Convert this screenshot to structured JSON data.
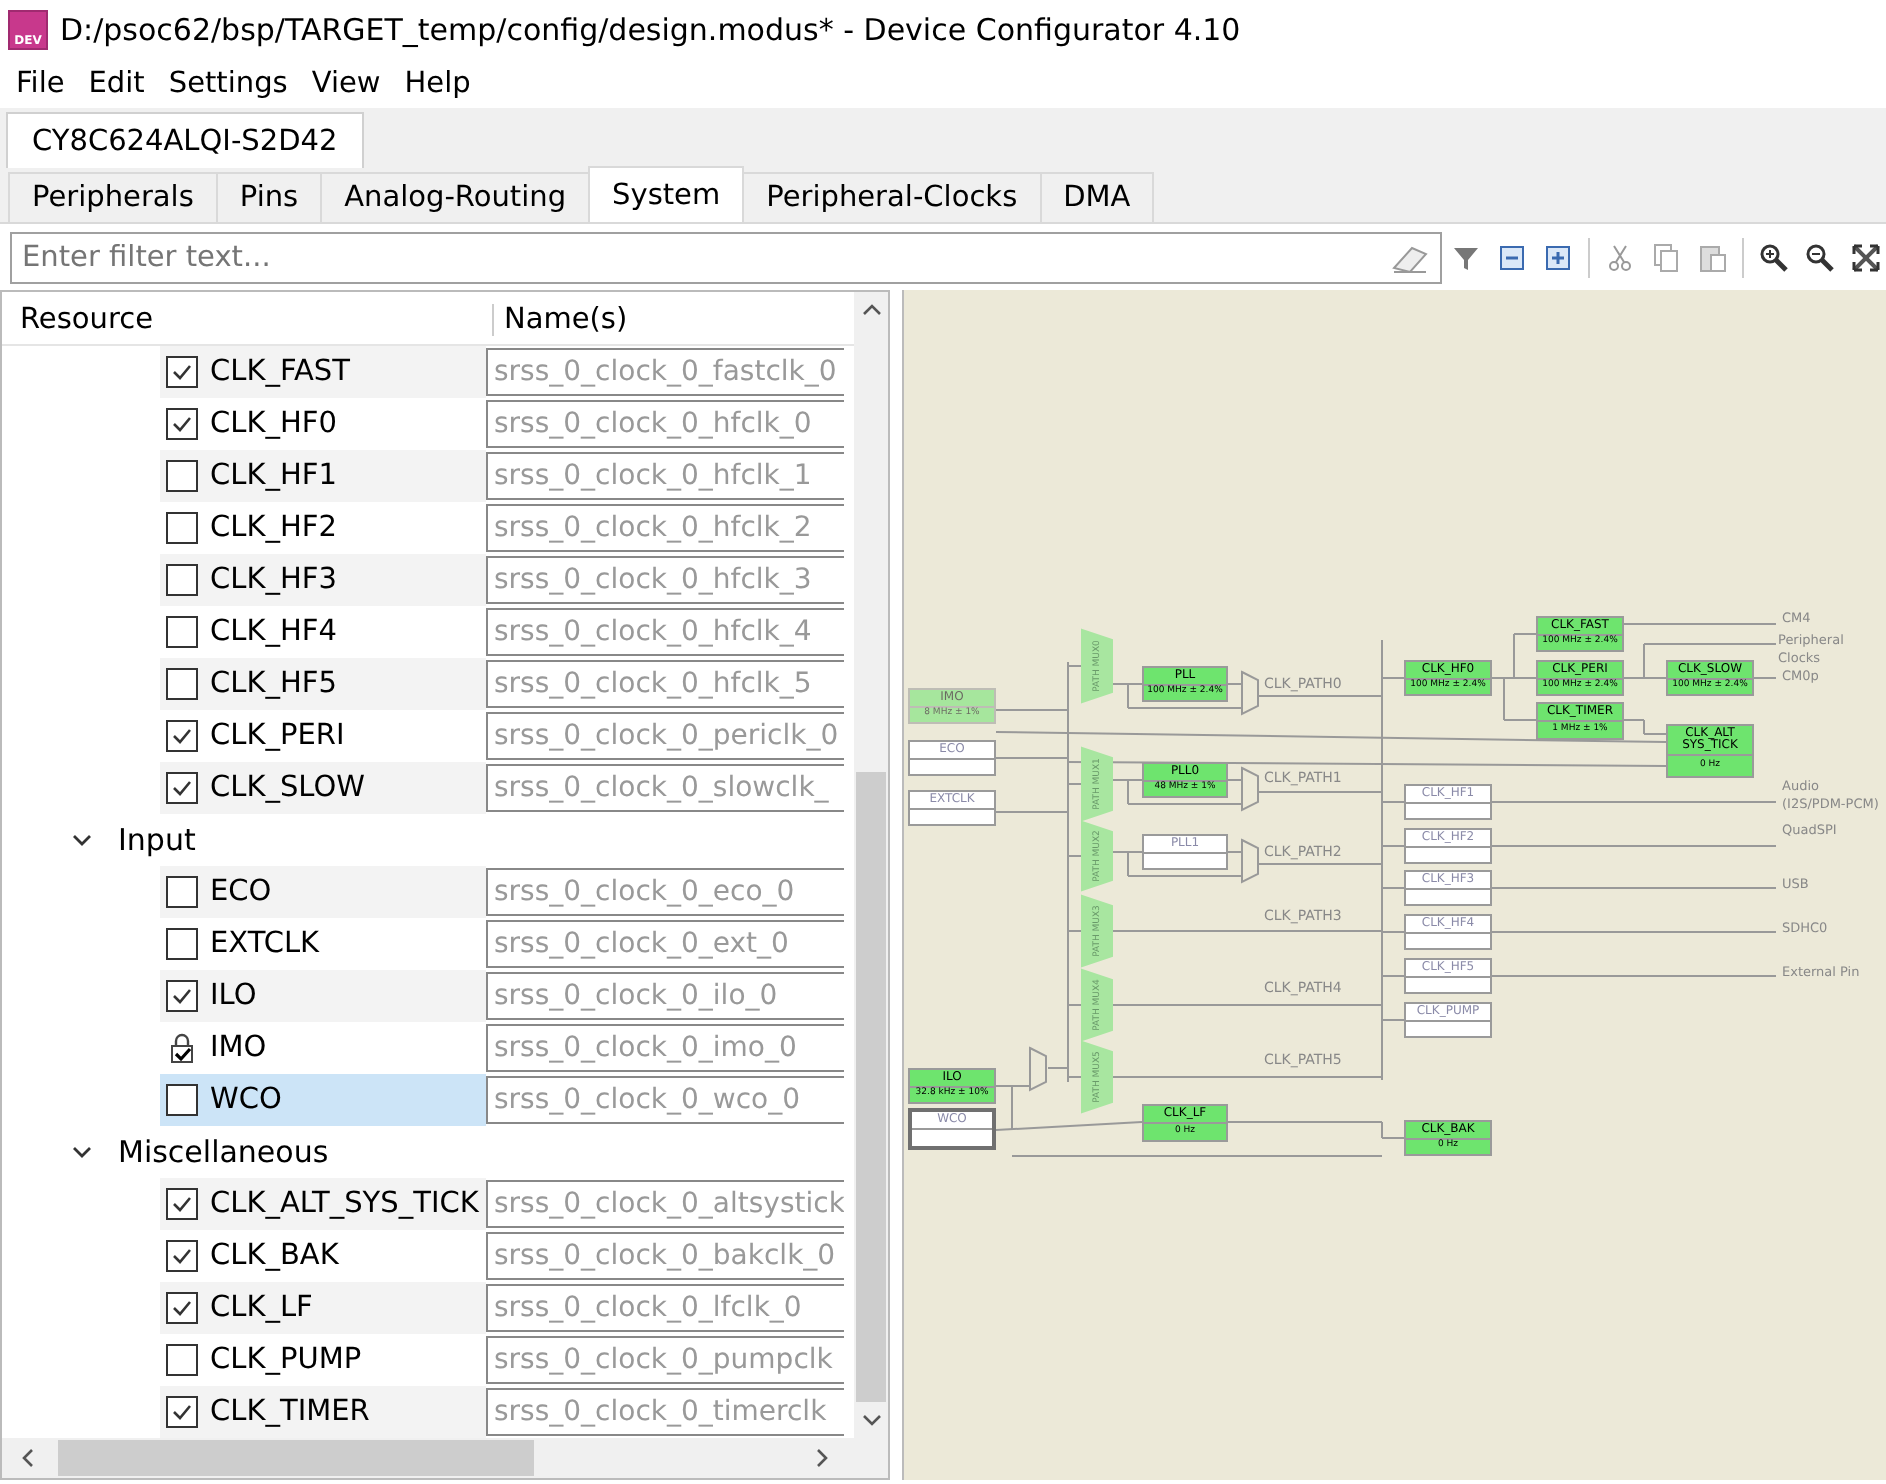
{
  "window": {
    "icon_text": "DEV",
    "title": "D:/psoc62/bsp/TARGET_temp/config/design.modus* - Device Configurator 4.10"
  },
  "menu": [
    "File",
    "Edit",
    "Settings",
    "View",
    "Help"
  ],
  "device_tab": {
    "label": "CY8C624ALQI-S2D42",
    "selected": true
  },
  "tabs": [
    {
      "label": "Peripherals",
      "selected": false
    },
    {
      "label": "Pins",
      "selected": false
    },
    {
      "label": "Analog-Routing",
      "selected": false
    },
    {
      "label": "System",
      "selected": true
    },
    {
      "label": "Peripheral-Clocks",
      "selected": false
    },
    {
      "label": "DMA",
      "selected": false
    }
  ],
  "filter": {
    "placeholder": "Enter filter text..."
  },
  "tree": {
    "columns": [
      "Resource",
      "Name(s)"
    ],
    "groups": [
      {
        "children": [
          {
            "kind": "checkbox",
            "label": "CLK_FAST",
            "name": "srss_0_clock_0_fastclk_0",
            "checked": true,
            "selected": false
          },
          {
            "kind": "checkbox",
            "label": "CLK_HF0",
            "name": "srss_0_clock_0_hfclk_0",
            "checked": true,
            "selected": false
          },
          {
            "kind": "checkbox",
            "label": "CLK_HF1",
            "name": "srss_0_clock_0_hfclk_1",
            "checked": false,
            "selected": false
          },
          {
            "kind": "checkbox",
            "label": "CLK_HF2",
            "name": "srss_0_clock_0_hfclk_2",
            "checked": false,
            "selected": false
          },
          {
            "kind": "checkbox",
            "label": "CLK_HF3",
            "name": "srss_0_clock_0_hfclk_3",
            "checked": false,
            "selected": false
          },
          {
            "kind": "checkbox",
            "label": "CLK_HF4",
            "name": "srss_0_clock_0_hfclk_4",
            "checked": false,
            "selected": false
          },
          {
            "kind": "checkbox",
            "label": "CLK_HF5",
            "name": "srss_0_clock_0_hfclk_5",
            "checked": false,
            "selected": false
          },
          {
            "kind": "checkbox",
            "label": "CLK_PERI",
            "name": "srss_0_clock_0_periclk_0",
            "checked": true,
            "selected": false
          },
          {
            "kind": "checkbox",
            "label": "CLK_SLOW",
            "name": "srss_0_clock_0_slowclk_",
            "checked": true,
            "selected": false
          }
        ]
      },
      {
        "label": "Input",
        "expanded": true,
        "children": [
          {
            "kind": "checkbox",
            "label": "ECO",
            "name": "srss_0_clock_0_eco_0",
            "checked": false,
            "selected": false
          },
          {
            "kind": "checkbox",
            "label": "EXTCLK",
            "name": "srss_0_clock_0_ext_0",
            "checked": false,
            "selected": false
          },
          {
            "kind": "checkbox",
            "label": "ILO",
            "name": "srss_0_clock_0_ilo_0",
            "checked": true,
            "selected": false
          },
          {
            "kind": "locked",
            "label": "IMO",
            "name": "srss_0_clock_0_imo_0",
            "checked": true,
            "selected": false
          },
          {
            "kind": "checkbox",
            "label": "WCO",
            "name": "srss_0_clock_0_wco_0",
            "checked": false,
            "selected": true
          }
        ]
      },
      {
        "label": "Miscellaneous",
        "expanded": true,
        "children": [
          {
            "kind": "checkbox",
            "label": "CLK_ALT_SYS_TICK",
            "name": "srss_0_clock_0_altsystick",
            "checked": true,
            "selected": false
          },
          {
            "kind": "checkbox",
            "label": "CLK_BAK",
            "name": "srss_0_clock_0_bakclk_0",
            "checked": true,
            "selected": false
          },
          {
            "kind": "checkbox",
            "label": "CLK_LF",
            "name": "srss_0_clock_0_lfclk_0",
            "checked": true,
            "selected": false
          },
          {
            "kind": "checkbox",
            "label": "CLK_PUMP",
            "name": "srss_0_clock_0_pumpclk",
            "checked": false,
            "selected": false
          },
          {
            "kind": "checkbox",
            "label": "CLK_TIMER",
            "name": "srss_0_clock_0_timerclk",
            "checked": true,
            "selected": false
          }
        ]
      }
    ]
  },
  "diagram": {
    "blocks": [
      {
        "label": "IMO",
        "reading": "8 MHz ± 1%",
        "enabled": true,
        "locked": true,
        "selected": false
      },
      {
        "label": "ECO",
        "enabled": false,
        "locked": false,
        "selected": false
      },
      {
        "label": "EXTCLK",
        "enabled": false,
        "locked": false,
        "selected": false
      },
      {
        "label": "PLL",
        "reading": "100 MHz ± 2.4%",
        "enabled": true,
        "locked": false,
        "selected": false
      },
      {
        "label": "PLL0",
        "reading": "48 MHz ± 1%",
        "enabled": true,
        "locked": false,
        "selected": false
      },
      {
        "label": "PLL1",
        "enabled": false,
        "locked": false,
        "selected": false
      },
      {
        "label": "ILO",
        "reading": "32.8 kHz ± 10%",
        "enabled": true,
        "locked": false,
        "selected": false
      },
      {
        "label": "WCO",
        "enabled": false,
        "locked": false,
        "selected": true
      },
      {
        "label": "CLK_LF",
        "reading": "0 Hz",
        "enabled": true,
        "locked": false,
        "selected": false
      },
      {
        "label": "CLK_HF0",
        "reading": "100 MHz ± 2.4%",
        "enabled": true,
        "locked": false,
        "selected": false
      },
      {
        "label": "CLK_FAST",
        "reading": "100 MHz ± 2.4%",
        "enabled": true,
        "locked": false,
        "selected": false
      },
      {
        "label": "CLK_PERI",
        "reading": "100 MHz ± 2.4%",
        "enabled": true,
        "locked": false,
        "selected": false
      },
      {
        "label": "CLK_TIMER",
        "reading": "1 MHz ± 1%",
        "enabled": true,
        "locked": false,
        "selected": false
      },
      {
        "label": "CLK_SLOW",
        "reading": "100 MHz ± 2.4%",
        "enabled": true,
        "locked": false,
        "selected": false
      },
      {
        "label": "CLK_ALT SYS_TICK",
        "reading": "0 Hz",
        "enabled": true,
        "locked": false,
        "selected": false
      },
      {
        "label": "CLK_HF1",
        "enabled": false,
        "locked": false,
        "selected": false
      },
      {
        "label": "CLK_HF2",
        "enabled": false,
        "locked": false,
        "selected": false
      },
      {
        "label": "CLK_HF3",
        "enabled": false,
        "locked": false,
        "selected": false
      },
      {
        "label": "CLK_HF4",
        "enabled": false,
        "locked": false,
        "selected": false
      },
      {
        "label": "CLK_HF5",
        "enabled": false,
        "locked": false,
        "selected": false
      },
      {
        "label": "CLK_PUMP",
        "enabled": false,
        "locked": false,
        "selected": false
      },
      {
        "label": "CLK_BAK",
        "reading": "0 Hz",
        "enabled": true,
        "locked": false,
        "selected": false
      }
    ],
    "muxes": [
      "PATH MUX0",
      "PATH MUX1",
      "PATH MUX2",
      "PATH MUX3",
      "PATH MUX4",
      "PATH MUX5"
    ],
    "paths": [
      "CLK_PATH0",
      "CLK_PATH1",
      "CLK_PATH2",
      "CLK_PATH3",
      "CLK_PATH4",
      "CLK_PATH5"
    ],
    "outputs": [
      "CM4",
      "Peripheral Clocks",
      "CM0p",
      "Audio (I2S/PDM-PCM)",
      "QuadSPI",
      "USB",
      "SDHC0",
      "External Pin"
    ]
  }
}
